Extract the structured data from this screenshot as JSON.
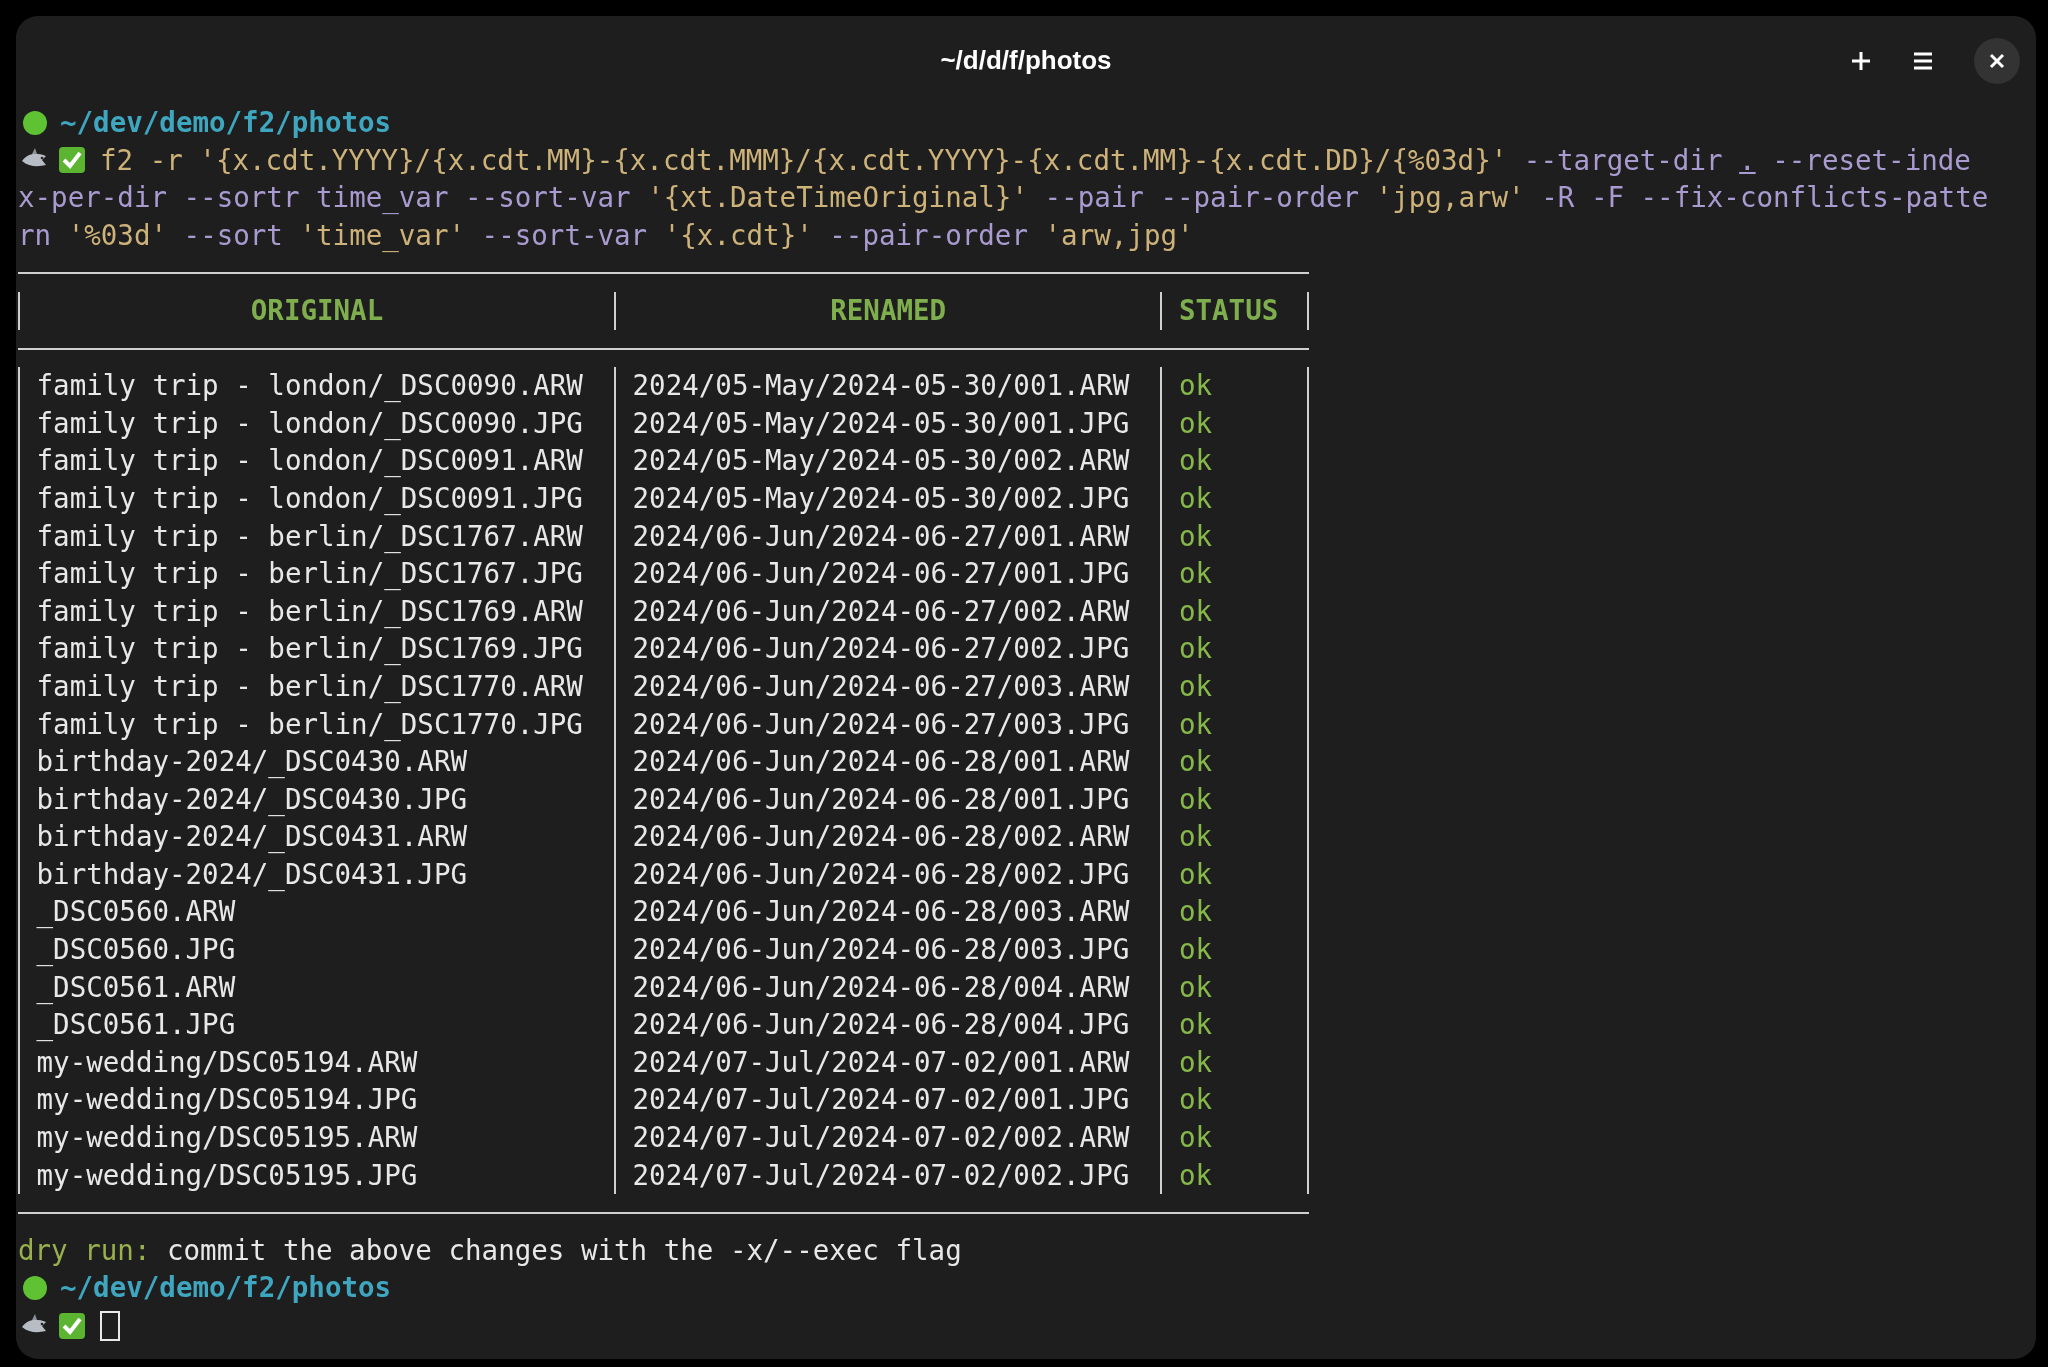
{
  "window": {
    "title": "~/d/d/f/photos"
  },
  "prompt_top": {
    "path": "~/dev/demo/f2/photos"
  },
  "command_lines": [
    {
      "segments": [
        {
          "kind": "arg",
          "text": "f2 -r '{x.cdt.YYYY}/{x.cdt.MM}-{x.cdt.MMM}/{x.cdt.YYYY}-{x.cdt.MM}-{x.cdt.DD}/{%03d}'"
        },
        {
          "kind": "flag",
          "text": " --target-dir "
        },
        {
          "kind": "path",
          "text": "."
        },
        {
          "kind": "flag",
          "text": " --reset-inde"
        }
      ]
    },
    {
      "segments": [
        {
          "kind": "flag",
          "text": "x-per-dir --sortr time_var --sort-var "
        },
        {
          "kind": "arg",
          "text": "'{xt.DateTimeOriginal}'"
        },
        {
          "kind": "flag",
          "text": " --pair --pair-order "
        },
        {
          "kind": "arg",
          "text": "'jpg,arw'"
        },
        {
          "kind": "flag",
          "text": " -R -F --fix-conflicts-patte"
        }
      ]
    },
    {
      "segments": [
        {
          "kind": "flag",
          "text": "rn "
        },
        {
          "kind": "arg",
          "text": "'%03d'"
        },
        {
          "kind": "flag",
          "text": " --sort "
        },
        {
          "kind": "arg",
          "text": "'time_var'"
        },
        {
          "kind": "flag",
          "text": " --sort-var "
        },
        {
          "kind": "arg",
          "text": "'{x.cdt}'"
        },
        {
          "kind": "flag",
          "text": " --pair-order "
        },
        {
          "kind": "arg",
          "text": "'arw,jpg'"
        }
      ]
    }
  ],
  "table": {
    "columns": [
      "ORIGINAL",
      "RENAMED",
      "STATUS"
    ],
    "rows": [
      [
        "family trip - london/_DSC0090.ARW",
        "2024/05-May/2024-05-30/001.ARW",
        "ok"
      ],
      [
        "family trip - london/_DSC0090.JPG",
        "2024/05-May/2024-05-30/001.JPG",
        "ok"
      ],
      [
        "family trip - london/_DSC0091.ARW",
        "2024/05-May/2024-05-30/002.ARW",
        "ok"
      ],
      [
        "family trip - london/_DSC0091.JPG",
        "2024/05-May/2024-05-30/002.JPG",
        "ok"
      ],
      [
        "family trip - berlin/_DSC1767.ARW",
        "2024/06-Jun/2024-06-27/001.ARW",
        "ok"
      ],
      [
        "family trip - berlin/_DSC1767.JPG",
        "2024/06-Jun/2024-06-27/001.JPG",
        "ok"
      ],
      [
        "family trip - berlin/_DSC1769.ARW",
        "2024/06-Jun/2024-06-27/002.ARW",
        "ok"
      ],
      [
        "family trip - berlin/_DSC1769.JPG",
        "2024/06-Jun/2024-06-27/002.JPG",
        "ok"
      ],
      [
        "family trip - berlin/_DSC1770.ARW",
        "2024/06-Jun/2024-06-27/003.ARW",
        "ok"
      ],
      [
        "family trip - berlin/_DSC1770.JPG",
        "2024/06-Jun/2024-06-27/003.JPG",
        "ok"
      ],
      [
        "birthday-2024/_DSC0430.ARW",
        "2024/06-Jun/2024-06-28/001.ARW",
        "ok"
      ],
      [
        "birthday-2024/_DSC0430.JPG",
        "2024/06-Jun/2024-06-28/001.JPG",
        "ok"
      ],
      [
        "birthday-2024/_DSC0431.ARW",
        "2024/06-Jun/2024-06-28/002.ARW",
        "ok"
      ],
      [
        "birthday-2024/_DSC0431.JPG",
        "2024/06-Jun/2024-06-28/002.JPG",
        "ok"
      ],
      [
        "_DSC0560.ARW",
        "2024/06-Jun/2024-06-28/003.ARW",
        "ok"
      ],
      [
        "_DSC0560.JPG",
        "2024/06-Jun/2024-06-28/003.JPG",
        "ok"
      ],
      [
        "_DSC0561.ARW",
        "2024/06-Jun/2024-06-28/004.ARW",
        "ok"
      ],
      [
        "_DSC0561.JPG",
        "2024/06-Jun/2024-06-28/004.JPG",
        "ok"
      ],
      [
        "my-wedding/DSC05194.ARW",
        "2024/07-Jul/2024-07-02/001.ARW",
        "ok"
      ],
      [
        "my-wedding/DSC05194.JPG",
        "2024/07-Jul/2024-07-02/001.JPG",
        "ok"
      ],
      [
        "my-wedding/DSC05195.ARW",
        "2024/07-Jul/2024-07-02/002.ARW",
        "ok"
      ],
      [
        "my-wedding/DSC05195.JPG",
        "2024/07-Jul/2024-07-02/002.JPG",
        "ok"
      ]
    ]
  },
  "notice": {
    "label": "dry run:",
    "message": "commit the above changes with the -x/--exec flag"
  },
  "prompt_bottom": {
    "path": "~/dev/demo/f2/photos"
  }
}
